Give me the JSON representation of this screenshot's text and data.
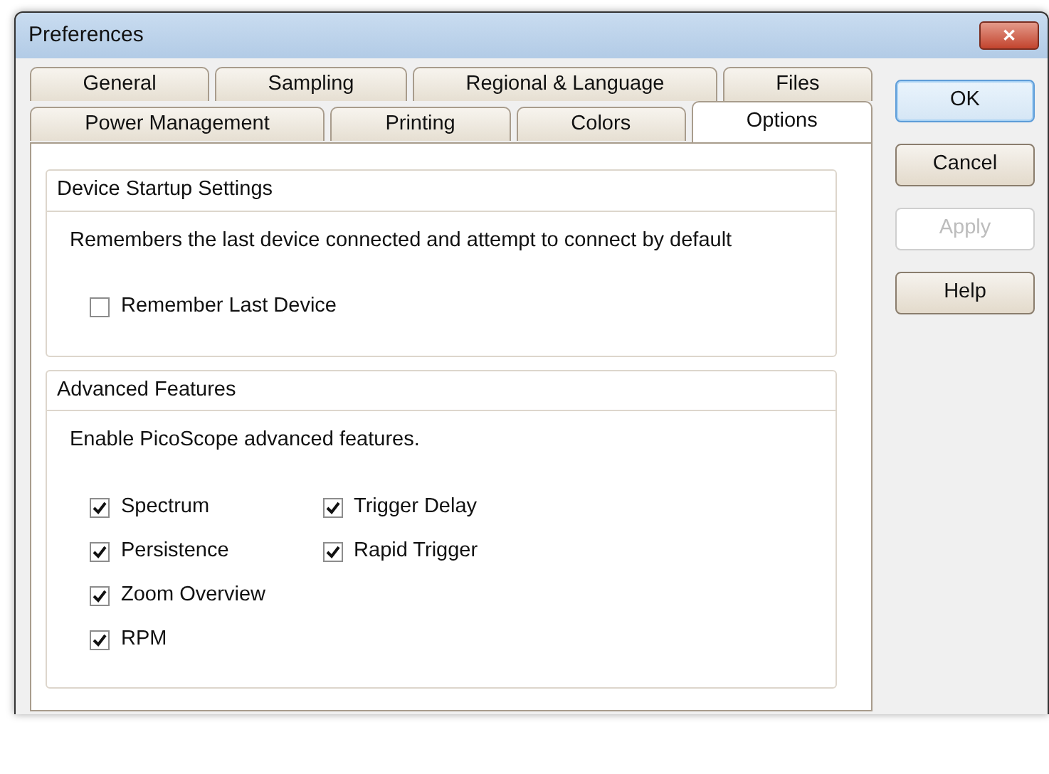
{
  "window": {
    "title": "Preferences",
    "close": "✕"
  },
  "tab_rows": [
    [
      {
        "label": "General",
        "selected": false
      },
      {
        "label": "Sampling",
        "selected": false
      },
      {
        "label": "Regional & Language",
        "selected": false
      },
      {
        "label": "Files",
        "selected": false
      }
    ],
    [
      {
        "label": "Power Management",
        "selected": false
      },
      {
        "label": "Printing",
        "selected": false
      },
      {
        "label": "Colors",
        "selected": false
      },
      {
        "label": "Options",
        "selected": true
      }
    ]
  ],
  "groups": [
    {
      "title": "Device Startup Settings",
      "description": "Remembers the last device connected and attempt to connect by default",
      "columns": [
        [
          {
            "label": "Remember Last Device",
            "checked": false
          }
        ]
      ]
    },
    {
      "title": "Advanced Features",
      "description": "Enable PicoScope advanced features.",
      "columns": [
        [
          {
            "label": "Spectrum",
            "checked": true
          },
          {
            "label": "Persistence",
            "checked": true
          },
          {
            "label": "Zoom Overview",
            "checked": true
          },
          {
            "label": "RPM",
            "checked": true
          }
        ],
        [
          {
            "label": "Trigger Delay",
            "checked": true
          },
          {
            "label": "Rapid Trigger",
            "checked": true
          }
        ]
      ]
    }
  ],
  "buttons": [
    {
      "label": "OK",
      "disabled": false,
      "default": true
    },
    {
      "label": "Cancel",
      "disabled": false,
      "default": false
    },
    {
      "label": "Apply",
      "disabled": true,
      "default": false
    },
    {
      "label": "Help",
      "disabled": false,
      "default": false
    }
  ]
}
